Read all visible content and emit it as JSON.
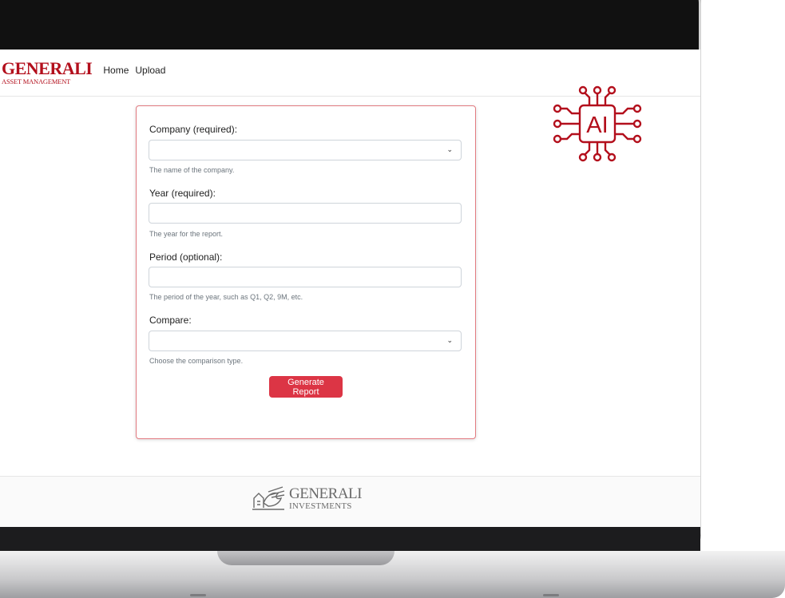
{
  "navbar": {
    "brand_name": "GENERALI",
    "brand_sub": "ASSET MANAGEMENT",
    "links": [
      "Home",
      "Upload"
    ]
  },
  "badge": {
    "ai_text": "AI"
  },
  "form": {
    "company": {
      "label": "Company (required):",
      "value": "",
      "help": "The name of the company."
    },
    "year": {
      "label": "Year (required):",
      "value": "",
      "help": "The year for the report."
    },
    "period": {
      "label": "Period (optional):",
      "value": "",
      "help": "The period of the year, such as Q1, Q2, 9M, etc."
    },
    "compare": {
      "label": "Compare:",
      "value": "",
      "help": "Choose the comparison type."
    },
    "submit_label": "Generate Report"
  },
  "footer": {
    "brand_name": "GENERALI",
    "brand_sub": "INVESTMENTS"
  },
  "colors": {
    "brand_red": "#b30f1c",
    "button_red": "#dc3545",
    "card_border": "#e27a80",
    "footer_gray": "#6b6b6b"
  },
  "icons": [
    "chevron-down-icon",
    "ai-chip-icon",
    "lion-logo-icon"
  ]
}
